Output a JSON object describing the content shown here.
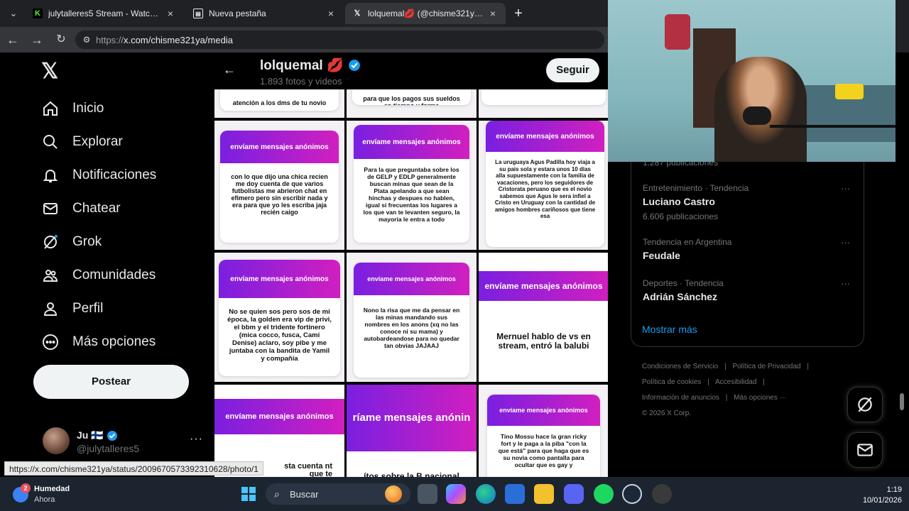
{
  "browser": {
    "tabs": [
      {
        "title": "julytalleres5 Stream - Watch Live o",
        "favicon": "K",
        "color": "#53fc18"
      },
      {
        "title": "Nueva pestaña",
        "favicon": "▤",
        "color": "#e8eaed"
      },
      {
        "title": "lolquemal💋 (@chisme321ya) / X",
        "favicon": "X",
        "color": "#e8eaed"
      }
    ],
    "url_prefix": "https://",
    "url_main": "x.com/chisme321ya/media"
  },
  "sidebar": {
    "items": [
      {
        "label": "Inicio",
        "icon": "home-icon"
      },
      {
        "label": "Explorar",
        "icon": "search-icon"
      },
      {
        "label": "Notificaciones",
        "icon": "bell-icon"
      },
      {
        "label": "Chatear",
        "icon": "mail-icon"
      },
      {
        "label": "Grok",
        "icon": "grok-icon"
      },
      {
        "label": "Comunidades",
        "icon": "people-icon"
      },
      {
        "label": "Perfil",
        "icon": "user-icon"
      },
      {
        "label": "Más opciones",
        "icon": "more-circle-icon"
      }
    ],
    "post_label": "Postear",
    "profile_name": "Ju 🇫🇮",
    "profile_handle": "@julytalleres5",
    "profile_more": "···"
  },
  "header": {
    "name": "lolquemal 💋",
    "subtitle": "1.893 fotos y videos",
    "follow": "Seguir"
  },
  "grid": {
    "header_text": "envíame mensajes anónimos",
    "top_partial": [
      "atención a los dms de tu novio",
      "para que los pagos sus sueldos en tiempo y forma",
      ""
    ],
    "row1": [
      "con lo que dijo una chica recien me doy cuenta de que varios futbolistas me abrieron chat en efimero pero sin escribir nada y era para que yo les escriba jaja recién caigo",
      "Para la que preguntaba sobre los de GELP y EDLP generalmente buscan minas que sean de la Plata apelando a que sean hinchas y despues no hablen, igual si frecuentas los lugares a los que van te levanten seguro, la mayoria le entra a todo",
      "La uruguaya Agus Padilla hoy viaja a su pais sola y estara unos 10 dias alla supuestamente con la familia de vacaciones, pero los seguidores de Cristorata peruano que es el novio sabemos que Agus le sera infiel a Cristo en Uruguay con la cantidad de amigos hombres cariñosos que tiene esa"
    ],
    "row2": [
      "No se quien sos pero sos de mi época, la golden era vip de privi, el bbm y el tridente fortinero (mica cocco, fusca, Cami Denise) aclaro, soy pibe y me juntaba con la bandita de Yamil y compañía",
      "Nono la risa que me da pensar en las minas mandando sus nombres en los anons (xq no las conoce ni su mama) y autobardeandose para no quedar tan obvias JAJAAJ",
      "Mernuel hablo de vs en stream, entró la balubi"
    ],
    "row3": [
      "sta cuenta nt que te",
      "ítos sobre la B nacional",
      "Tino Mossu hace la gran ricky fort y le paga a la piba \"con la que está\" para que haga que es su novia como pantalla para ocultar que es gay y"
    ],
    "row3_band2": "ríame mensajes anónin"
  },
  "trends": {
    "first_count": "1.287 publicaciones",
    "items": [
      {
        "category": "Entretenimiento · Tendencia",
        "name": "Luciano Castro",
        "count": "6.606 publicaciones"
      },
      {
        "category": "Tendencia en Argentina",
        "name": "Feudale",
        "count": ""
      },
      {
        "category": "Deportes · Tendencia",
        "name": "Adrián Sánchez",
        "count": ""
      }
    ],
    "show_more": "Mostrar más",
    "more": "···"
  },
  "footer": {
    "links": [
      "Condiciones de Servicio",
      "|",
      "Política de Privacidad",
      "|",
      "Política de cookies",
      "|",
      "Accesibilidad",
      "|",
      "Información de anuncios",
      "|",
      "Más opciones ···"
    ],
    "copyright": "© 2026 X Corp."
  },
  "status_url": "https://x.com/chisme321ya/status/2009670573392310628/photo/1",
  "taskbar": {
    "weather_title": "Humedad",
    "weather_sub": "Ahora",
    "weather_badge": "2",
    "search": "Buscar",
    "time": "1:19",
    "date": "10/01/2026"
  }
}
